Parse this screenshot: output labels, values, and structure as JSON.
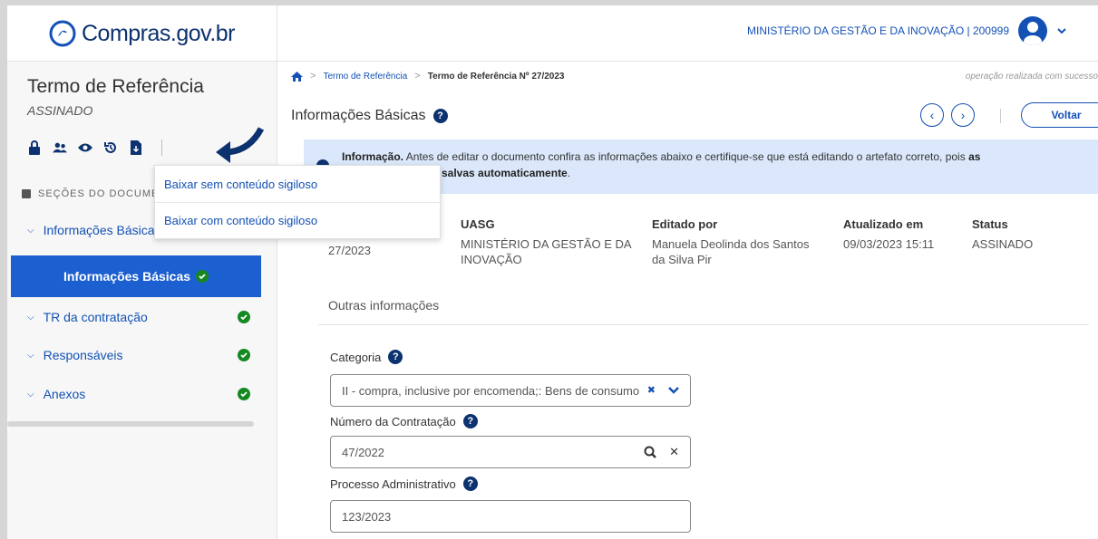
{
  "header": {
    "logo_text": "Compras.gov.br",
    "org_label": "MINISTÉRIO DA GESTÃO E DA INOVAÇÃO | 200999"
  },
  "sidebar": {
    "title": "Termo de Referência",
    "status": "ASSINADO",
    "icons": [
      "lock-icon",
      "users-icon",
      "eye-icon",
      "history-icon",
      "download-file-icon"
    ],
    "sections_header": "SEÇÕES DO DOCUMEN",
    "items": [
      {
        "label": "Informações Básica"
      },
      {
        "label": "Informações Básicas"
      },
      {
        "label": "TR da contratação"
      },
      {
        "label": "Responsáveis"
      },
      {
        "label": "Anexos"
      }
    ]
  },
  "dropdown": {
    "items": [
      {
        "label": "Baixar sem conteúdo sigiloso"
      },
      {
        "label": "Baixar com conteúdo sigiloso"
      }
    ]
  },
  "main": {
    "breadcrumb": [
      "Termo de Referência",
      "Termo de Referência Nº 27/2023"
    ],
    "success_message": "operação realizada com sucesso",
    "page_title": "Informações Básicas",
    "voltar_label": "Voltar",
    "info": {
      "strong": "Informação.",
      "text1": " Antes de editar o documento confira as informações abaixo e certifique-se que está editando o artefato correto, pois ",
      "strong2": "as",
      "text2_strong": "salvas automaticamente",
      "text2_end": "."
    },
    "details": {
      "number_value": "27/2023",
      "uasg_header": "UASG",
      "uasg_value": "MINISTÉRIO DA GESTÃO E DA INOVAÇÃO",
      "editado_header": "Editado por",
      "editado_value": "Manuela Deolinda dos Santos da Silva Pir",
      "atualizado_header": "Atualizado em",
      "atualizado_value": "09/03/2023 15:11",
      "status_header": "Status",
      "status_value": "ASSINADO"
    },
    "outras_label": "Outras informações",
    "categoria": {
      "label": "Categoria",
      "value": "II - compra, inclusive por encomenda;: Bens de consumo"
    },
    "numero_contratacao": {
      "label": "Número da Contratação",
      "value": "47/2022"
    },
    "processo": {
      "label": "Processo Administrativo",
      "value": "123/2023"
    }
  }
}
